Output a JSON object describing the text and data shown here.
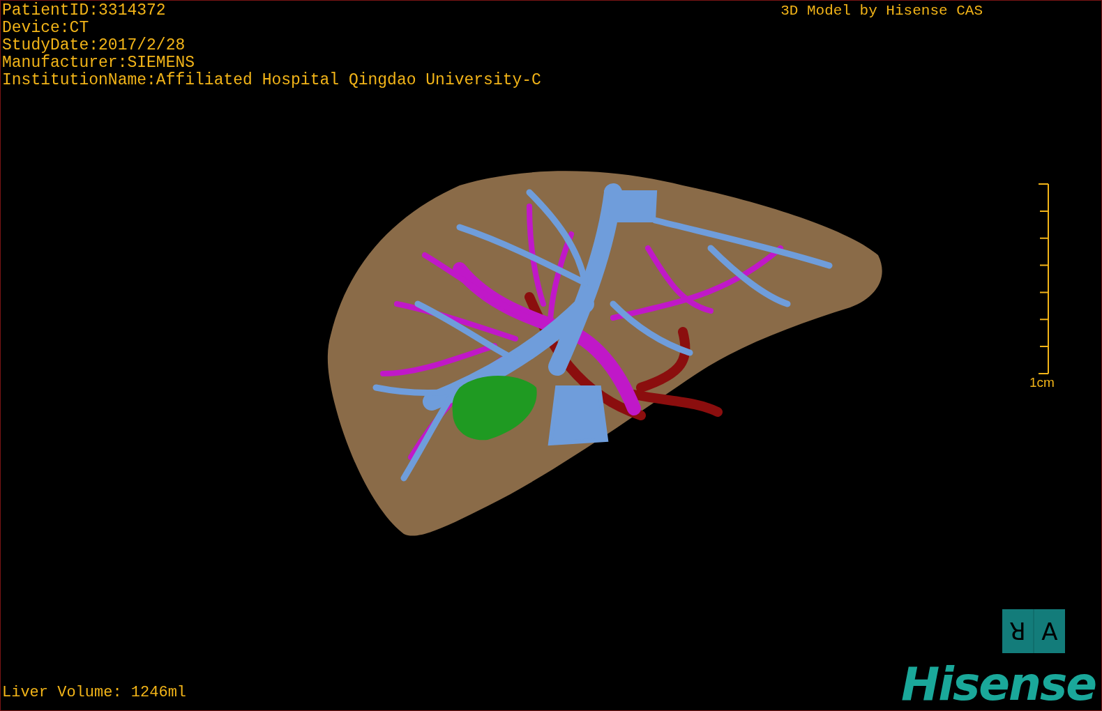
{
  "info_lines": [
    "PatientID:3314372",
    "Device:CT",
    "StudyDate:2017/2/28",
    "Manufacturer:SIEMENS",
    "InstitutionName:Affiliated Hospital Qingdao University-C"
  ],
  "title": "3D Model by Hisense CAS",
  "scale_bar": {
    "label": "1cm"
  },
  "liver_volume": "Liver Volume: 1246ml",
  "orientation_cube": [
    {
      "letter": "R",
      "turned": true
    },
    {
      "letter": "A",
      "turned": false
    }
  ],
  "logo": "Hisense"
}
